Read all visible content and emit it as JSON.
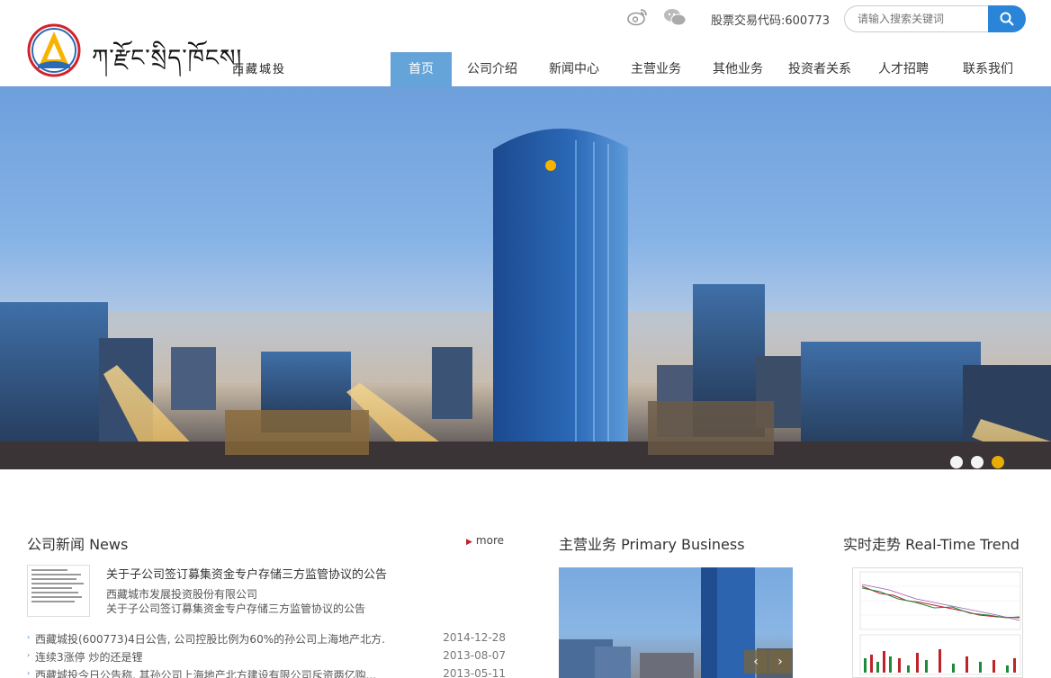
{
  "header": {
    "logo_script": "ཀ་རྫོང་སྲིད་ཁོངས།",
    "logo_cn": "西藏城投",
    "stock_label": "股票交易代码:600773",
    "search_placeholder": "请输入搜索关键词"
  },
  "social": {
    "weibo_icon": "weibo-icon",
    "wechat_icon": "wechat-icon",
    "search_icon": "search-icon"
  },
  "nav": {
    "items": [
      {
        "label": "首页",
        "active": true
      },
      {
        "label": "公司介绍"
      },
      {
        "label": "新闻中心"
      },
      {
        "label": "主营业务"
      },
      {
        "label": "其他业务"
      },
      {
        "label": "投资者关系"
      },
      {
        "label": "人才招聘"
      },
      {
        "label": "联系我们"
      }
    ]
  },
  "banner": {
    "slides_total": 3,
    "active_slide": 3
  },
  "news": {
    "title": "公司新闻 News",
    "more_label": "more",
    "featured_title": "关于子公司签订募集资金专户存储三方监管协议的公告",
    "featured_desc_1": "西藏城市发展投资股份有限公司",
    "featured_desc_2": "关于子公司签订募集资金专户存储三方监管协议的公告",
    "items": [
      {
        "text": "西藏城投(600773)4日公告, 公司控股比例为60%的孙公司上海地产北方...",
        "date": "2014-12-28"
      },
      {
        "text": "连续3涨停 炒的还是锂",
        "date": "2013-08-07"
      },
      {
        "text": "西藏城投今日公告称, 其孙公司上海地产北方建设有限公司斥资两亿购...",
        "date": "2013-05-11"
      }
    ]
  },
  "business": {
    "title": "主营业务 Primary Business",
    "prev_icon": "chevron-left-icon",
    "next_icon": "chevron-right-icon"
  },
  "trend": {
    "title": "实时走势 Real-Time Trend"
  },
  "colors": {
    "accent": "#2a84d8",
    "nav_active": "#65a4d8",
    "dot_active": "#f0b400"
  }
}
